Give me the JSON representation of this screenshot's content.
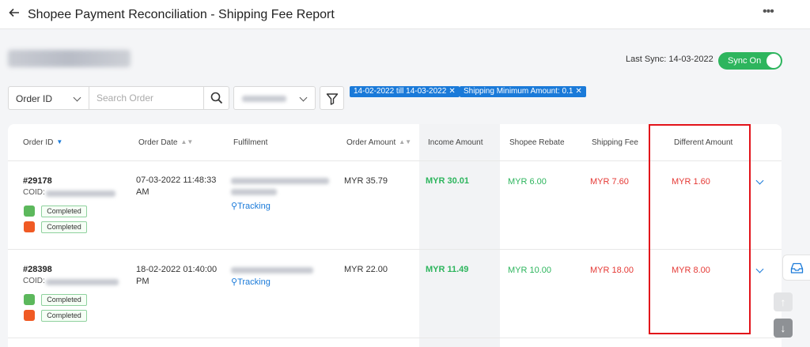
{
  "header": {
    "title": "Shopee Payment Reconciliation - Shipping Fee Report",
    "back_icon": "arrow-left-icon",
    "more_icon": "more-dots-icon"
  },
  "sync": {
    "label": "Last Sync: 14-03-2022",
    "toggle_label": "Sync On",
    "toggle_on": true
  },
  "filters": {
    "search_by": "Order ID",
    "search_placeholder": "Search Order",
    "chips": [
      "14-02-2022 till 14-03-2022",
      "Shipping Minimum Amount: 0.1"
    ]
  },
  "table": {
    "columns": [
      "Order ID",
      "Order Date",
      "Fulfilment",
      "Order Amount",
      "Income Amount",
      "Shopee Rebate",
      "Shipping Fee",
      "Different Amount"
    ],
    "rows": [
      {
        "order_id": "#29178",
        "coid_label": "COID:",
        "status_1": "Completed",
        "status_2": "Completed",
        "order_date": "07-03-2022 11:48:33 AM",
        "tracking": "Tracking",
        "order_amount": "MYR 35.79",
        "income_amount": "MYR 30.01",
        "shopee_rebate": "MYR 6.00",
        "shipping_fee": "MYR 7.60",
        "different_amount": "MYR 1.60"
      },
      {
        "order_id": "#28398",
        "coid_label": "COID:",
        "status_1": "Completed",
        "status_2": "Completed",
        "order_date": "18-02-2022 01:40:00 PM",
        "tracking": "Tracking",
        "order_amount": "MYR 22.00",
        "income_amount": "MYR 11.49",
        "shopee_rebate": "MYR 10.00",
        "shipping_fee": "MYR 18.00",
        "different_amount": "MYR 8.00"
      }
    ]
  },
  "colors": {
    "accent": "#1a7ad9",
    "positive": "#2db55d",
    "negative": "#e53935",
    "highlight_box": "#e2131a"
  }
}
